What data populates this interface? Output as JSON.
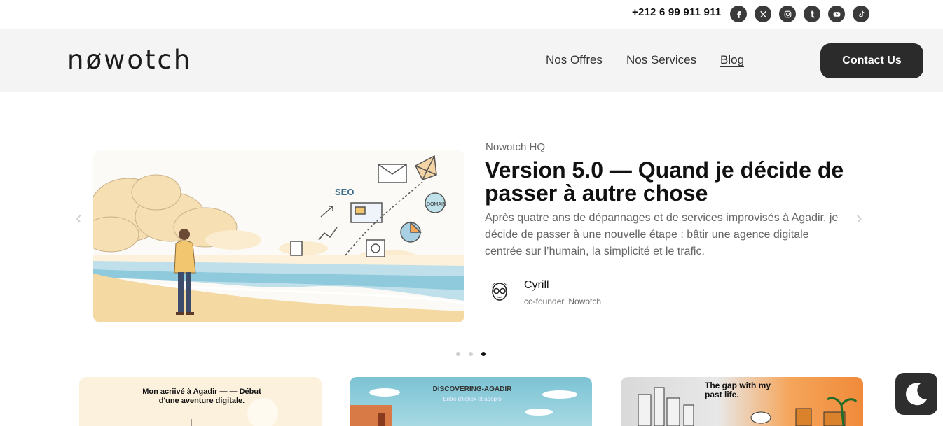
{
  "topbar": {
    "phone": "+212 6 99 911 911",
    "socials": [
      "facebook-icon",
      "x-icon",
      "instagram-icon",
      "tumblr-icon",
      "youtube-icon",
      "tiktok-icon"
    ]
  },
  "header": {
    "logo": "nøwotch",
    "nav": {
      "offres": "Nos Offres",
      "services": "Nos Services",
      "blog": "Blog"
    },
    "contact_label": "Contact Us"
  },
  "hero": {
    "kicker": "Nowotch HQ",
    "title": "Version 5.0 — Quand je décide de passer à autre chose",
    "excerpt": "Après quatre ans de dépannages et de services improvisés à Agadir, je décide de passer à une nouvelle étape : bâtir une agence digitale centrée sur l’humain, la simplicité et le trafic.",
    "author": {
      "name": "Cyrill",
      "role": "co-founder, Nowotch"
    },
    "illustration": {
      "seo": "SEO",
      "domain": "DOMAIN"
    },
    "slides": {
      "total": 3,
      "active": 3
    }
  },
  "cards": [
    {
      "title": "Mon acriivé à Agadir — — Début d'une aventure digitale."
    },
    {
      "title": "DISCOVERING-AGADIR",
      "subtitle": "Entre d'lichex et apoprs"
    },
    {
      "title": "The gap with my past life."
    }
  ],
  "colors": {
    "accent": "#2b2b2b",
    "header_bg": "#f4f4f4"
  }
}
